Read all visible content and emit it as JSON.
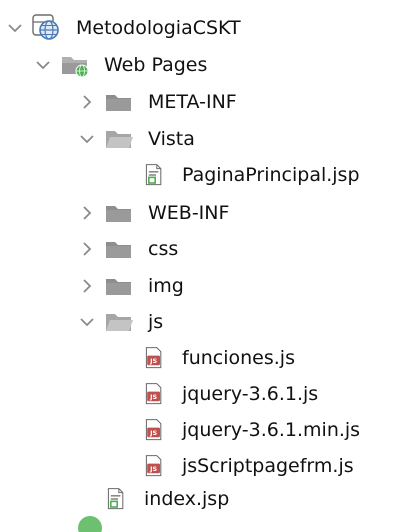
{
  "project_tree": {
    "project": {
      "label": "MetodologiaCSKT",
      "icon": "globe-project-icon",
      "state": "expanded"
    },
    "web_pages": {
      "label": "Web Pages",
      "icon": "web-pages-folder-icon",
      "state": "expanded"
    },
    "meta_inf": {
      "label": "META-INF",
      "icon": "folder-icon",
      "state": "collapsed"
    },
    "vista": {
      "label": "Vista",
      "icon": "folder-open-icon",
      "state": "expanded"
    },
    "pagina_principal": {
      "label": "PaginaPrincipal.jsp",
      "icon": "jsp-file-icon"
    },
    "web_inf": {
      "label": "WEB-INF",
      "icon": "folder-icon",
      "state": "collapsed"
    },
    "css": {
      "label": "css",
      "icon": "folder-icon",
      "state": "collapsed"
    },
    "img": {
      "label": "img",
      "icon": "folder-icon",
      "state": "collapsed"
    },
    "js": {
      "label": "js",
      "icon": "folder-open-icon",
      "state": "expanded"
    },
    "funciones": {
      "label": "funciones.js",
      "icon": "js-file-icon"
    },
    "jquery": {
      "label": "jquery-3.6.1.js",
      "icon": "js-file-icon"
    },
    "jquery_min": {
      "label": "jquery-3.6.1.min.js",
      "icon": "js-file-icon"
    },
    "jsscript": {
      "label": "jsScriptpagefrm.js",
      "icon": "js-file-icon"
    },
    "index": {
      "label": "index.jsp",
      "icon": "jsp-file-icon"
    }
  },
  "colors": {
    "chevron": "#8a8a8a",
    "folder_closed": "#8e8e8e",
    "folder_open": "#b0b0b0",
    "js_badge": "#c0504d",
    "globe": "#4a7ab5",
    "green_badge": "#4caf50",
    "text": "#111111"
  }
}
